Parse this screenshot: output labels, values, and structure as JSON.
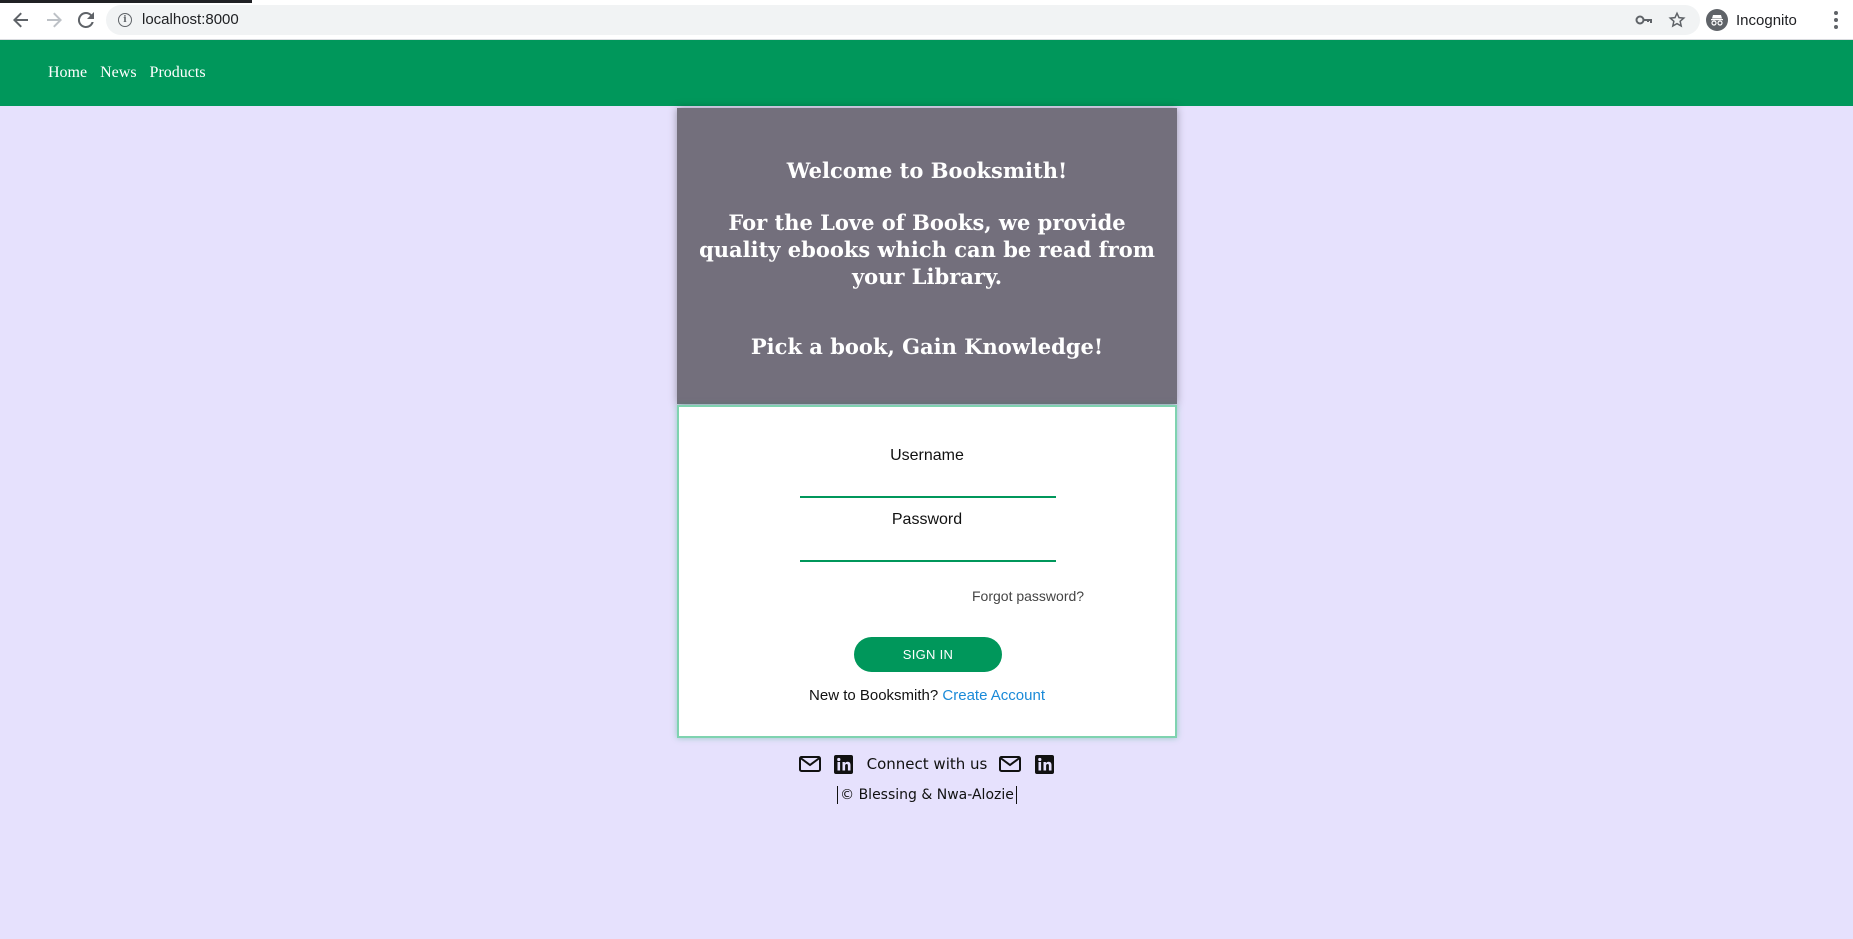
{
  "browser": {
    "url": "localhost:8000",
    "profile_label": "Incognito",
    "icons": [
      "back-icon",
      "forward-icon",
      "reload-icon",
      "info-icon",
      "key-icon",
      "star-icon",
      "incognito-icon",
      "more-vert-icon"
    ]
  },
  "nav": {
    "items": [
      {
        "label": "Home"
      },
      {
        "label": "News"
      },
      {
        "label": "Products"
      }
    ],
    "background": "#00975b"
  },
  "hero": {
    "welcome": "Welcome to Booksmith!",
    "tagline": "For the Love of Books, we provide quality ebooks which can be read from your Library.",
    "slogan": "Pick a book, Gain Knowledge!",
    "background": "#736f7c"
  },
  "login": {
    "username_label": "Username",
    "username_value": "",
    "password_label": "Password",
    "password_value": "",
    "forgot_label": "Forgot password?",
    "signin_label": "SIGN IN",
    "new_prompt": "New to Booksmith?",
    "create_label": "Create Account",
    "link_color": "#1a8ad8"
  },
  "footer": {
    "connect_label": "Connect with us",
    "copyright": "© Blessing & Nwa-Alozie",
    "icons": [
      "mail-icon",
      "linkedin-icon",
      "mail-icon",
      "linkedin-icon"
    ]
  },
  "colors": {
    "page_background": "#e6e1fd",
    "accent": "#00975b"
  }
}
